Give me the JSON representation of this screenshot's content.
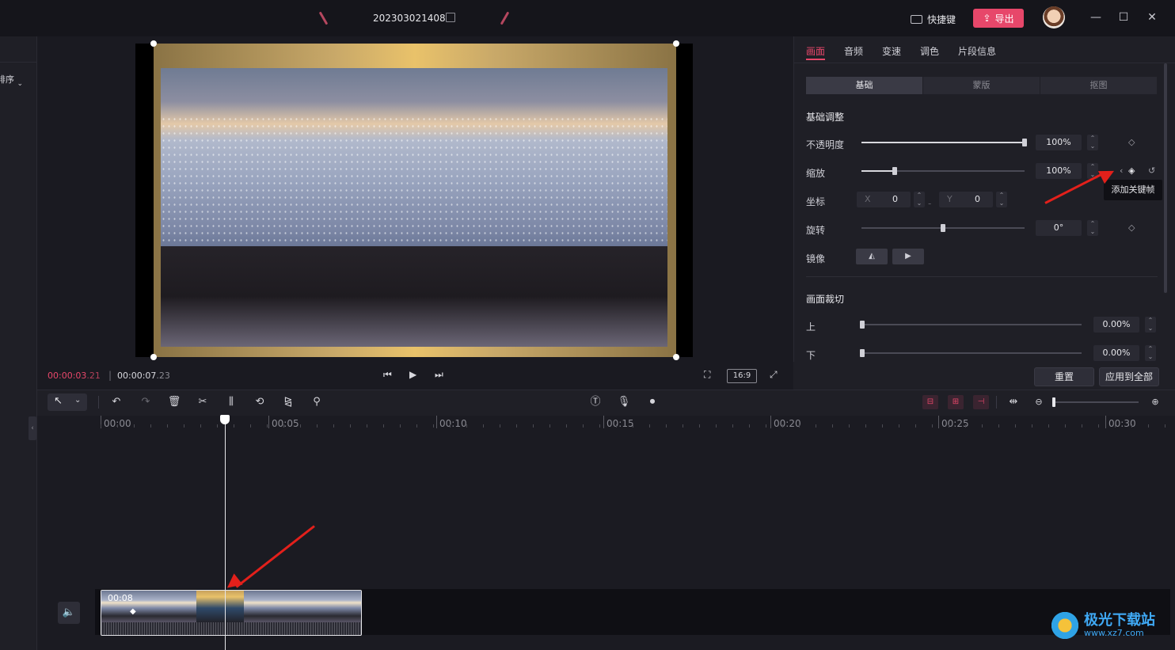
{
  "titlebar": {
    "project_name": "202303021408",
    "shortcut_label": "快捷键",
    "export_label": "导出",
    "minimize": "—",
    "maximize": "☐",
    "close": "✕"
  },
  "left_panel": {
    "sort_label": "排序"
  },
  "preview": {
    "current_time_main": "00:00:03",
    "current_time_frames": ".21",
    "total_time_main": "00:00:07",
    "total_time_frames": ".23",
    "aspect_ratio": "16:9"
  },
  "inspector": {
    "tabs": [
      "画面",
      "音频",
      "变速",
      "调色",
      "片段信息"
    ],
    "active_tab": "画面",
    "subtabs": [
      "基础",
      "蒙版",
      "抠图"
    ],
    "basic_title": "基础调整",
    "opacity": {
      "label": "不透明度",
      "value": "100%",
      "level": 1.0
    },
    "scale": {
      "label": "缩放",
      "value": "100%",
      "level": 0.2
    },
    "position": {
      "label": "坐标",
      "x_axis": "X",
      "x_value": "0",
      "y_axis": "Y",
      "y_value": "0"
    },
    "rotation": {
      "label": "旋转",
      "value": "0°",
      "level": 0.5
    },
    "mirror": {
      "label": "镜像"
    },
    "crop_title": "画面裁切",
    "crop_top": {
      "label": "上",
      "value": "0.00%"
    },
    "crop_bottom": {
      "label": "下",
      "value": "0.00%"
    },
    "tooltip": "添加关键帧",
    "reset_label": "重置",
    "apply_all_label": "应用到全部"
  },
  "timeline": {
    "ruler": [
      "00:00",
      "00:05",
      "00:10",
      "00:15",
      "00:20",
      "00:25",
      "00:30"
    ],
    "clip_duration": "00:08"
  },
  "watermark": {
    "main": "极光下载站",
    "sub": "www.xz7.com"
  },
  "colors": {
    "accent": "#e7476a",
    "background": "#1b1b22",
    "panel": "#1f1f26",
    "arrow": "#e3201b"
  }
}
